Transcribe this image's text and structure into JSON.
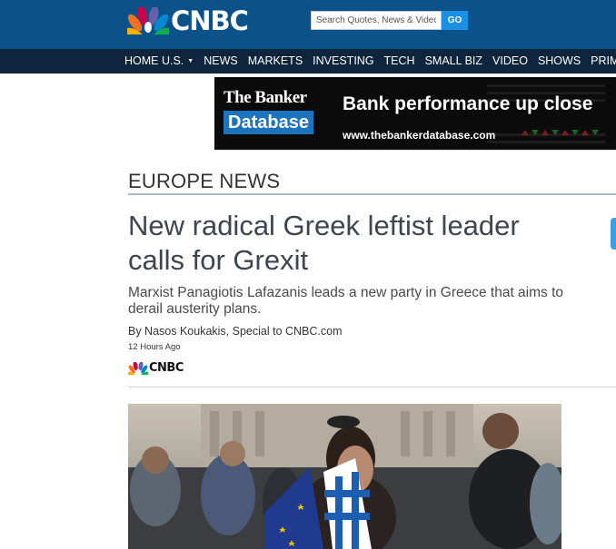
{
  "header": {
    "logo_text": "CNBC",
    "search_placeholder": "Search Quotes, News & Video",
    "go_label": "GO",
    "colors": {
      "header_bg": "#0a5289",
      "nav_bg": "#0f253d",
      "go_button": "#1a8fe3"
    }
  },
  "nav": {
    "items": [
      {
        "label": "HOME U.S.",
        "has_dropdown": true
      },
      {
        "label": "NEWS"
      },
      {
        "label": "MARKETS"
      },
      {
        "label": "INVESTING"
      },
      {
        "label": "TECH"
      },
      {
        "label": "SMALL BIZ"
      },
      {
        "label": "VIDEO"
      },
      {
        "label": "SHOWS"
      },
      {
        "label": "PRIMET"
      }
    ]
  },
  "ad": {
    "brand_top": "The Banker",
    "brand_box": "Database",
    "headline": "Bank performance up close",
    "url": "www.thebankerdatabase.com"
  },
  "article": {
    "section": "EUROPE NEWS",
    "headline": "New radical Greek leftist leader calls for Grexit",
    "dek": "Marxist Panagiotis Lafazanis leads a new party in Greece that aims to derail austerity plans.",
    "byline": "By Nasos Koukakis, Special to CNBC.com",
    "timestamp": "12 Hours Ago",
    "source_logo_text": "CNBC"
  }
}
